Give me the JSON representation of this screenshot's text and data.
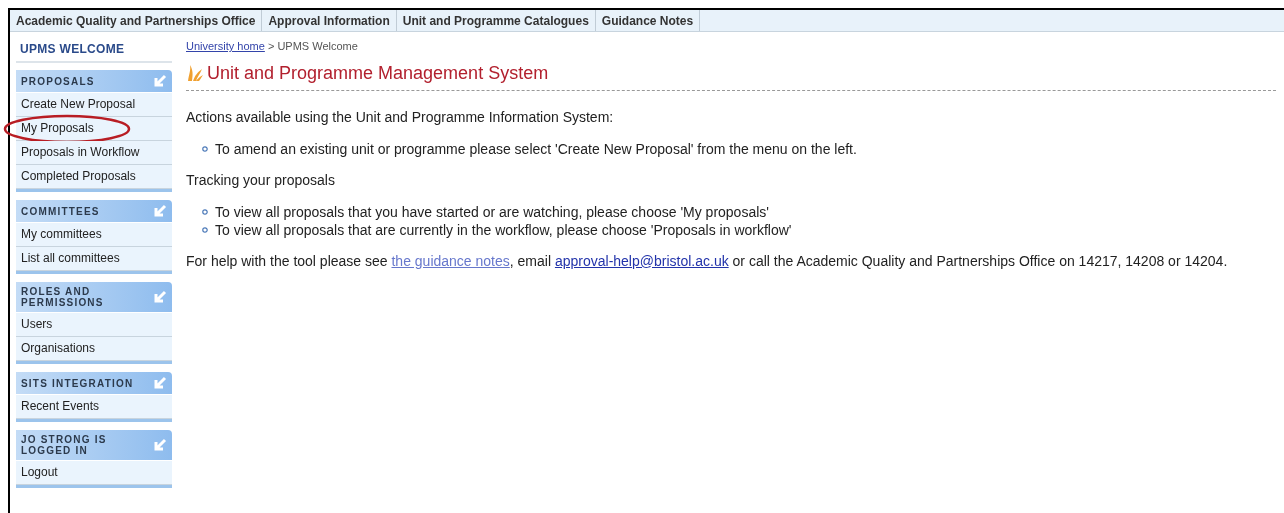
{
  "top_nav": [
    {
      "label": "Academic Quality and Partnerships Office"
    },
    {
      "label": "Approval Information"
    },
    {
      "label": "Unit and Programme Catalogues"
    },
    {
      "label": "Guidance Notes"
    }
  ],
  "sidebar": {
    "title": "UPMS WELCOME",
    "sections": [
      {
        "heading": "PROPOSALS",
        "items": [
          {
            "label": "Create New Proposal",
            "circled": false
          },
          {
            "label": "My Proposals",
            "circled": true
          },
          {
            "label": "Proposals in Workflow",
            "circled": false
          },
          {
            "label": "Completed Proposals",
            "circled": false
          }
        ]
      },
      {
        "heading": "COMMITTEES",
        "items": [
          {
            "label": "My committees",
            "circled": false
          },
          {
            "label": "List all committees",
            "circled": false
          }
        ]
      },
      {
        "heading": "ROLES AND PERMISSIONS",
        "items": [
          {
            "label": "Users",
            "circled": false
          },
          {
            "label": "Organisations",
            "circled": false
          }
        ]
      },
      {
        "heading": "SITS INTEGRATION",
        "items": [
          {
            "label": "Recent Events",
            "circled": false
          }
        ]
      },
      {
        "heading": "JO STRONG IS LOGGED IN",
        "items": [
          {
            "label": "Logout",
            "circled": false
          }
        ]
      }
    ]
  },
  "breadcrumb": {
    "link": "University home",
    "separator": ">",
    "current": "UPMS Welcome"
  },
  "page_title": "Unit and Programme Management System",
  "content": [
    {
      "kind": "paragraph",
      "text": "Actions available using the Unit and Programme Information System:"
    },
    {
      "kind": "list",
      "items": [
        "To amend an existing unit or programme please select 'Create New Proposal' from the menu on the left."
      ]
    },
    {
      "kind": "paragraph",
      "text": "Tracking your proposals"
    },
    {
      "kind": "list",
      "items": [
        "To view all proposals that you have started or are watching, please choose 'My proposals'",
        "To view all proposals that are currently in the workflow, please choose 'Proposals in workflow'"
      ]
    }
  ],
  "help": {
    "before": "For help with the tool please see",
    "guide_link": "the guidance notes",
    "middle": ", email",
    "email_link": "approval-help@bristol.ac.uk",
    "after": "or call the Academic Quality and Partnerships Office on 14217, 14208 or 14204."
  }
}
